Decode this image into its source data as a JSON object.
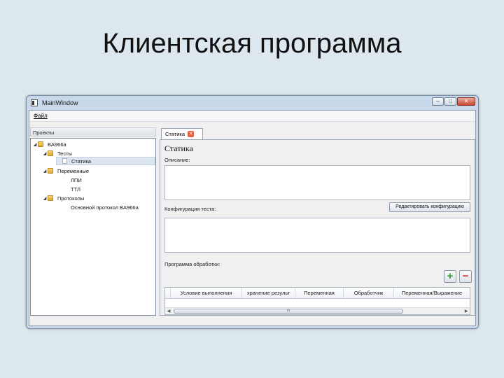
{
  "slide": {
    "title": "Клиентская программа"
  },
  "window": {
    "title": "MainWindow",
    "controls": {
      "minimize": "–",
      "maximize": "□",
      "close": "✕"
    }
  },
  "menu": {
    "file": "Файл"
  },
  "left_panel": {
    "header": "Проекты",
    "tree": [
      {
        "label": "BA966a",
        "level": 0,
        "type": "folder",
        "expanded": true
      },
      {
        "label": "Тесты",
        "level": 1,
        "type": "folder",
        "expanded": true
      },
      {
        "label": "Статика",
        "level": 2,
        "type": "doc",
        "selected": true
      },
      {
        "label": "Переменные",
        "level": 1,
        "type": "folder",
        "expanded": true
      },
      {
        "label": "ЛПИ",
        "level": 2,
        "type": "blank"
      },
      {
        "label": "ТТЛ",
        "level": 2,
        "type": "blank"
      },
      {
        "label": "Протоколы",
        "level": 1,
        "type": "folder",
        "expanded": true
      },
      {
        "label": "Основной протокол BA966a",
        "level": 2,
        "type": "blank"
      }
    ]
  },
  "tab": {
    "label": "Статика",
    "close": "✕"
  },
  "editor": {
    "title": "Статика",
    "description_label": "Описание:",
    "config_label": "Конфигурация теста:",
    "edit_config_button": "Редактировать конфигурацию",
    "processing_label": "Программа обработки:",
    "add_button": "+",
    "remove_button": "−",
    "columns": [
      "Условие выполнения",
      "хранение результ",
      "Переменная",
      "Обработчик",
      "Переменная/Выражение"
    ],
    "scroll_grip": "III"
  }
}
